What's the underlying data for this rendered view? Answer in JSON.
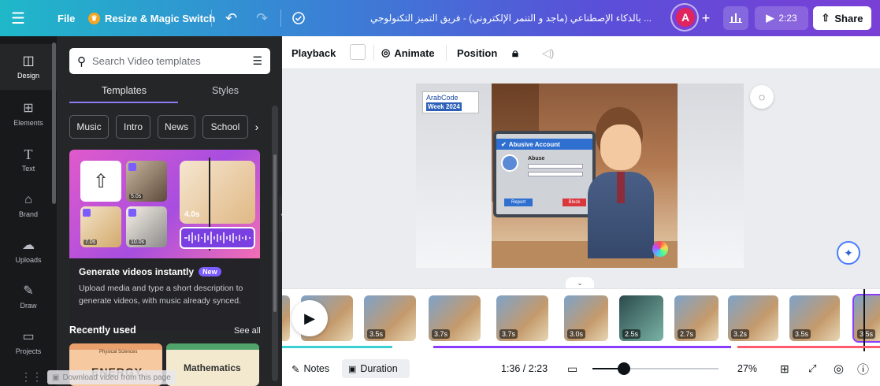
{
  "topbar": {
    "menu_icon": "hamburger-icon",
    "file_label": "File",
    "resize_label": "Resize & Magic Switch",
    "undo_icon": "undo-icon",
    "redo_icon": "redo-icon",
    "cloud_icon": "cloud-check-icon",
    "doc_title": "... بالذكاء الإصطناعي (ماجد و التنمر الإلكتروني) - فريق التميز التكنولوجي",
    "avatar_letter": "A",
    "add_label": "+",
    "play_time": "2:23",
    "share_label": "Share"
  },
  "rail": {
    "items": [
      {
        "label": "Design",
        "icon": "layout-icon"
      },
      {
        "label": "Elements",
        "icon": "shapes-icon"
      },
      {
        "label": "Text",
        "icon": "text-icon"
      },
      {
        "label": "Brand",
        "icon": "brand-icon"
      },
      {
        "label": "Uploads",
        "icon": "cloud-upload-icon"
      },
      {
        "label": "Draw",
        "icon": "pen-icon"
      },
      {
        "label": "Projects",
        "icon": "folder-icon"
      }
    ]
  },
  "panel": {
    "search_placeholder": "Search Video templates",
    "tabs": [
      "Templates",
      "Styles"
    ],
    "chips": [
      "Music",
      "Intro",
      "News",
      "School"
    ],
    "promo_thumb_times": [
      "4.0s",
      "7.0s",
      "10.0s",
      "5.0s"
    ],
    "promo_title": "Generate videos instantly",
    "promo_badge": "New",
    "promo_desc_1": "Upload media and type a short description to",
    "promo_desc_2": "generate videos, with music already synced.",
    "recent_title": "Recently used",
    "see_all": "See all",
    "recent_cards": [
      "Physical Sciences",
      "ENERGY",
      "Mathematics"
    ],
    "watermark": "Download video from this page"
  },
  "stage_toolbar": {
    "playback": "Playback",
    "animate": "Animate",
    "position": "Position"
  },
  "canvas": {
    "logo_line1": "ArabCode",
    "logo_line2": "Week 2024",
    "dialog_title": "Abusive Account",
    "dialog_label": "Abuse",
    "btn_left": "Report",
    "btn_right": "Block"
  },
  "timeline": {
    "durations": [
      "",
      "",
      "3.5s",
      "3.7s",
      "3.7s",
      "3.0s",
      "2.5s",
      "2.7s",
      "3.2s",
      "3.5s",
      "3.5s"
    ]
  },
  "bottombar": {
    "notes": "Notes",
    "duration": "Duration",
    "time": "1:36 / 2:23",
    "zoom": "27%"
  },
  "colors": {
    "accent": "#8b3dff",
    "topbar_start": "#1fb8c9",
    "topbar_end": "#7a3fd6",
    "avatar": "#e0245e"
  }
}
